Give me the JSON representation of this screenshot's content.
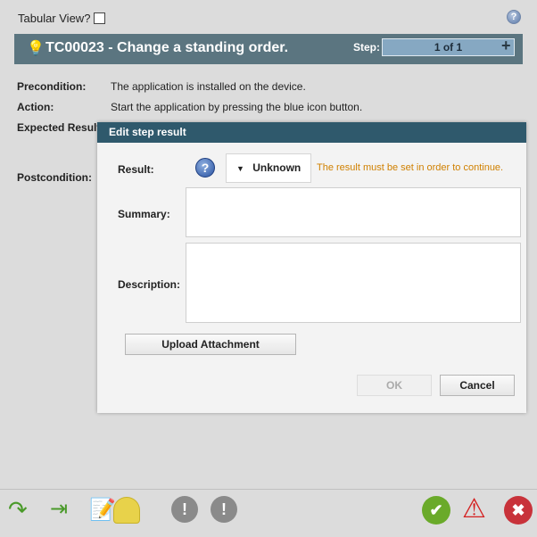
{
  "top": {
    "tabular_view_label": "Tabular View?",
    "tabular_view_checked": false
  },
  "header": {
    "title": "TC00023 - Change a standing order.",
    "step_label": "Step:",
    "step_value": "1 of 1",
    "add_icon": "plus-icon",
    "bulb_icon": "lightbulb-icon"
  },
  "details": {
    "precondition_label": "Precondition:",
    "precondition_value": "The application is installed on the device.",
    "action_label": "Action:",
    "action_value": "Start the application by pressing the blue icon button.",
    "expected_label": "Expected Result",
    "postcondition_label": "Postcondition:"
  },
  "dialog": {
    "title": "Edit step result",
    "result_label": "Result:",
    "result_value": "Unknown",
    "result_warning": "The result must be set in order to continue.",
    "summary_label": "Summary:",
    "summary_value": "",
    "description_label": "Description:",
    "description_value": "",
    "upload_label": "Upload Attachment",
    "ok_label": "OK",
    "cancel_label": "Cancel"
  },
  "toolbar": {
    "left_icons": [
      "redo-arrow-icon",
      "skip-to-end-icon",
      "notepad-edit-icon",
      "hard-hat-icon",
      "exclamation-icon",
      "exclamation-redo-icon"
    ],
    "right_icons": [
      "pass-check-icon",
      "warning-triangle-icon",
      "fail-x-icon"
    ]
  },
  "colors": {
    "header": "#5b7580",
    "dialog_title": "#2f596c",
    "warning_text": "#d08000",
    "pass": "#6aaa2a",
    "fail": "#c8323a"
  }
}
